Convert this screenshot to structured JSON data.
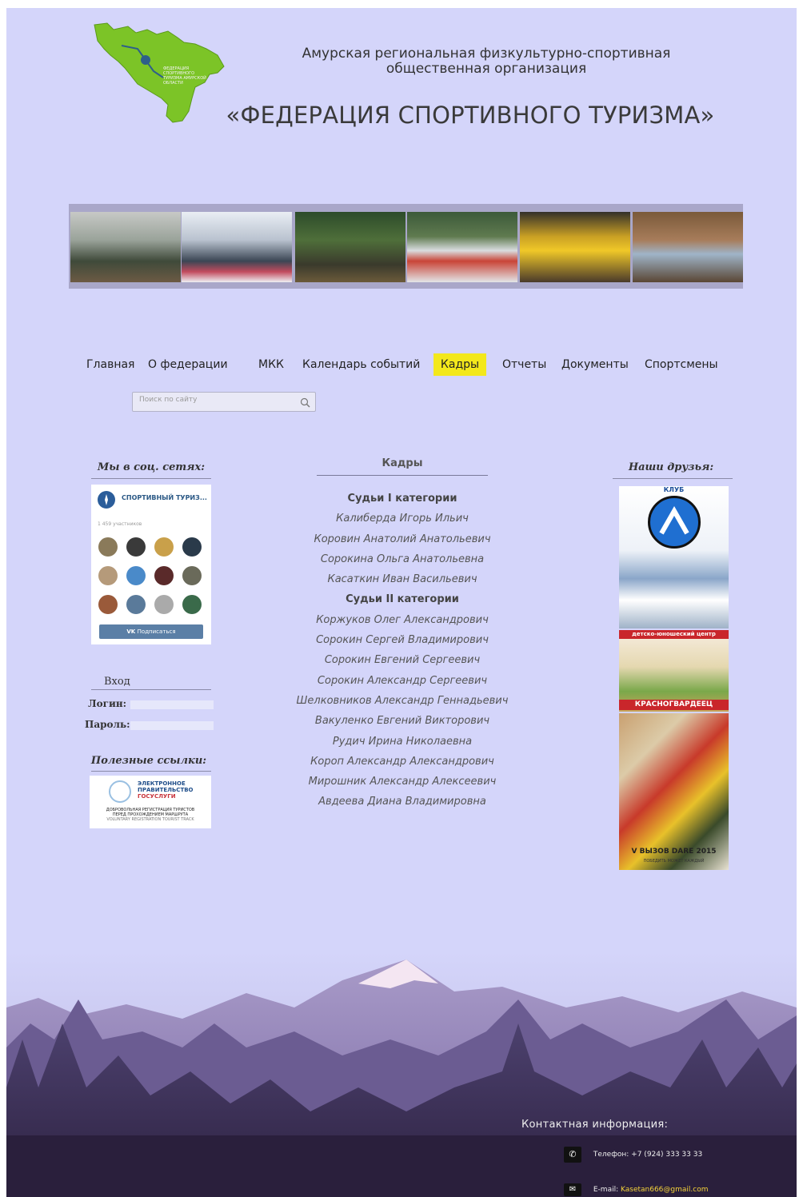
{
  "header": {
    "logo_text": "ФЕДЕРАЦИЯ СПОРТИВНОГО ТУРИЗМА АМУРСКОЙ ОБЛАСТИ",
    "org_line1": "Амурская региональная физкультурно-спортивная",
    "org_line2": "общественная организация",
    "org_title": "«ФЕДЕРАЦИЯ СПОРТИВНОГО ТУРИЗМА»"
  },
  "nav": {
    "items": [
      "Главная",
      "О федерации",
      "МКК",
      "Календарь событий",
      "Кадры",
      "Отчеты",
      "Документы",
      "Спортсмены"
    ],
    "active": "Кадры"
  },
  "search": {
    "placeholder": "Поиск по сайту",
    "icon": "search-icon"
  },
  "social": {
    "title": "Мы в соц. сетях:",
    "group_name": "СПОРТИВНЫЙ ТУРИЗ...",
    "members": "1 459 участников",
    "subscribe": "Подписаться"
  },
  "login": {
    "title": "Вход",
    "login_label": "Логин:",
    "password_label": "Пароль:"
  },
  "links": {
    "title": "Полезные ссылки:",
    "banner_line1": "ЭЛЕКТРОННОЕ",
    "banner_line2": "ПРАВИТЕЛЬСТВО",
    "banner_line3": "ГОСУСЛУГИ",
    "banner_line4": "ДОБРОВОЛЬНАЯ РЕГИСТРАЦИЯ ТУРИСТОВ",
    "banner_line5": "ПЕРЕД ПРОХОЖДЕНИЕМ МАРШРУТА",
    "banner_line6": "VOLUNTARY REGISTRATION TOURIST TRACK"
  },
  "content": {
    "title": "Кадры",
    "sections": [
      {
        "category": "Судьи I категории",
        "names": [
          "Калиберда Игорь Ильич",
          "Коровин Анатолий Анатольевич",
          "Сорокина Ольга Анатольевна",
          "Касаткин Иван Васильевич"
        ]
      },
      {
        "category": "Судьи II категории",
        "names": [
          "Коржуков Олег Александрович",
          "Сорокин Сергей Владимирович",
          "Сорокин Евгений Сергеевич",
          "Сорокин Александр Сергеевич",
          "Шелковников Александр Геннадьевич",
          "Вакуленко Евгений Викторович",
          "Рудич Ирина Николаевна",
          "Короп Александр Александрович",
          "Мирошник Александр Алексеевич",
          "Авдеева Диана Владимировна"
        ]
      }
    ]
  },
  "friends": {
    "title": "Наши друзья:",
    "club_label": "КЛУБ",
    "center_label": "детско-юношеский центр",
    "center_name": "КРАСНОГВАРДЕЕЦ",
    "challenge": "V ВЫЗОВ DARE 2015",
    "challenge_sub": "ПОБЕДИТЬ МОЖЕТ КАЖДЫЙ"
  },
  "contacts": {
    "title": "Контактная информация:",
    "phone": "Телефон: +7 (924) 333 33 33",
    "email_label": "E-mail:",
    "email": "Kasetan666@gmail.com"
  },
  "colors": {
    "page_bg": "#d4d5fa",
    "nav_active": "#f3e81b",
    "logo_green": "#7cc427",
    "email_color": "#f5d33a"
  }
}
